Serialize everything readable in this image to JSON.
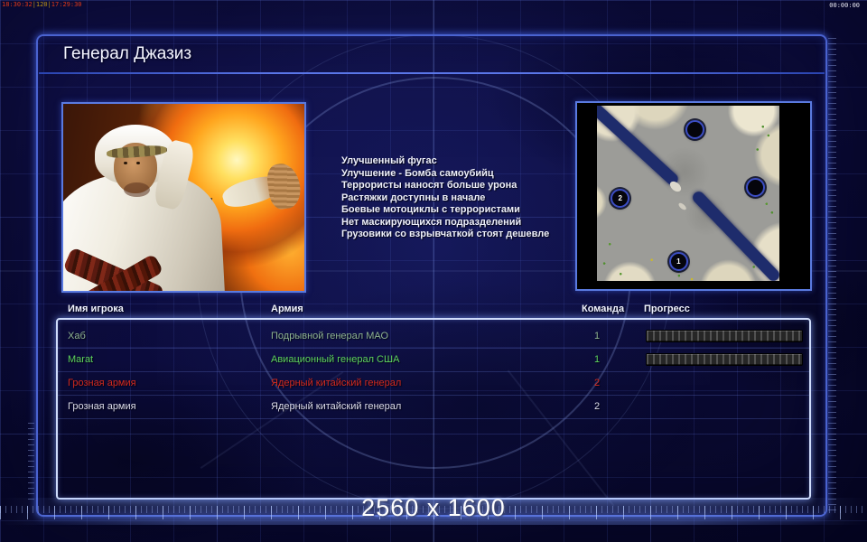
{
  "hud": {
    "debug_time_a": "18:30:32",
    "debug_fps": "|120|",
    "debug_time_b": "17:29:30",
    "match_timer": "00:00:00"
  },
  "window": {
    "title": "Генерал Джазиз"
  },
  "general_info": {
    "perks": [
      "Улучшенный фугас",
      "Улучшение - Бомба самоубийц",
      "Террористы наносят больше урона",
      "Растяжки доступны в начале",
      "Боевые мотоциклы с террористами",
      "Нет маскирующихся подразделений",
      "Грузовики со взрывчаткой стоят дешевле"
    ]
  },
  "minimap": {
    "markers": [
      {
        "label": "",
        "x": 53,
        "y": 13
      },
      {
        "label": "",
        "x": 86,
        "y": 46
      },
      {
        "label": "2",
        "x": 12,
        "y": 52
      },
      {
        "label": "1",
        "x": 44,
        "y": 88
      }
    ]
  },
  "players_table": {
    "headers": {
      "name": "Имя игрока",
      "army": "Армия",
      "team": "Команда",
      "progress": "Прогресс"
    },
    "rows": [
      {
        "name": "Хаб",
        "army": "Подрывной генерал МАО",
        "team": "1",
        "progress": 100,
        "color": "#8fb492"
      },
      {
        "name": "Marat",
        "army": "Авиационный генерал США",
        "team": "1",
        "progress": 100,
        "color": "#5ed45e"
      },
      {
        "name": "Грозная армия",
        "army": "Ядерный китайский генерал",
        "team": "2",
        "progress": 0,
        "color": "#d42a1e"
      },
      {
        "name": "Грозная армия",
        "army": "Ядерный китайский генерал",
        "team": "2",
        "progress": 0,
        "color": "#dcdcea"
      }
    ]
  },
  "footer": {
    "resolution_label": "2560 x 1600"
  },
  "colors": {
    "frame_accent": "#4a63d0",
    "panel_border": "#cfdcfb",
    "background": "#0b0b3a"
  }
}
